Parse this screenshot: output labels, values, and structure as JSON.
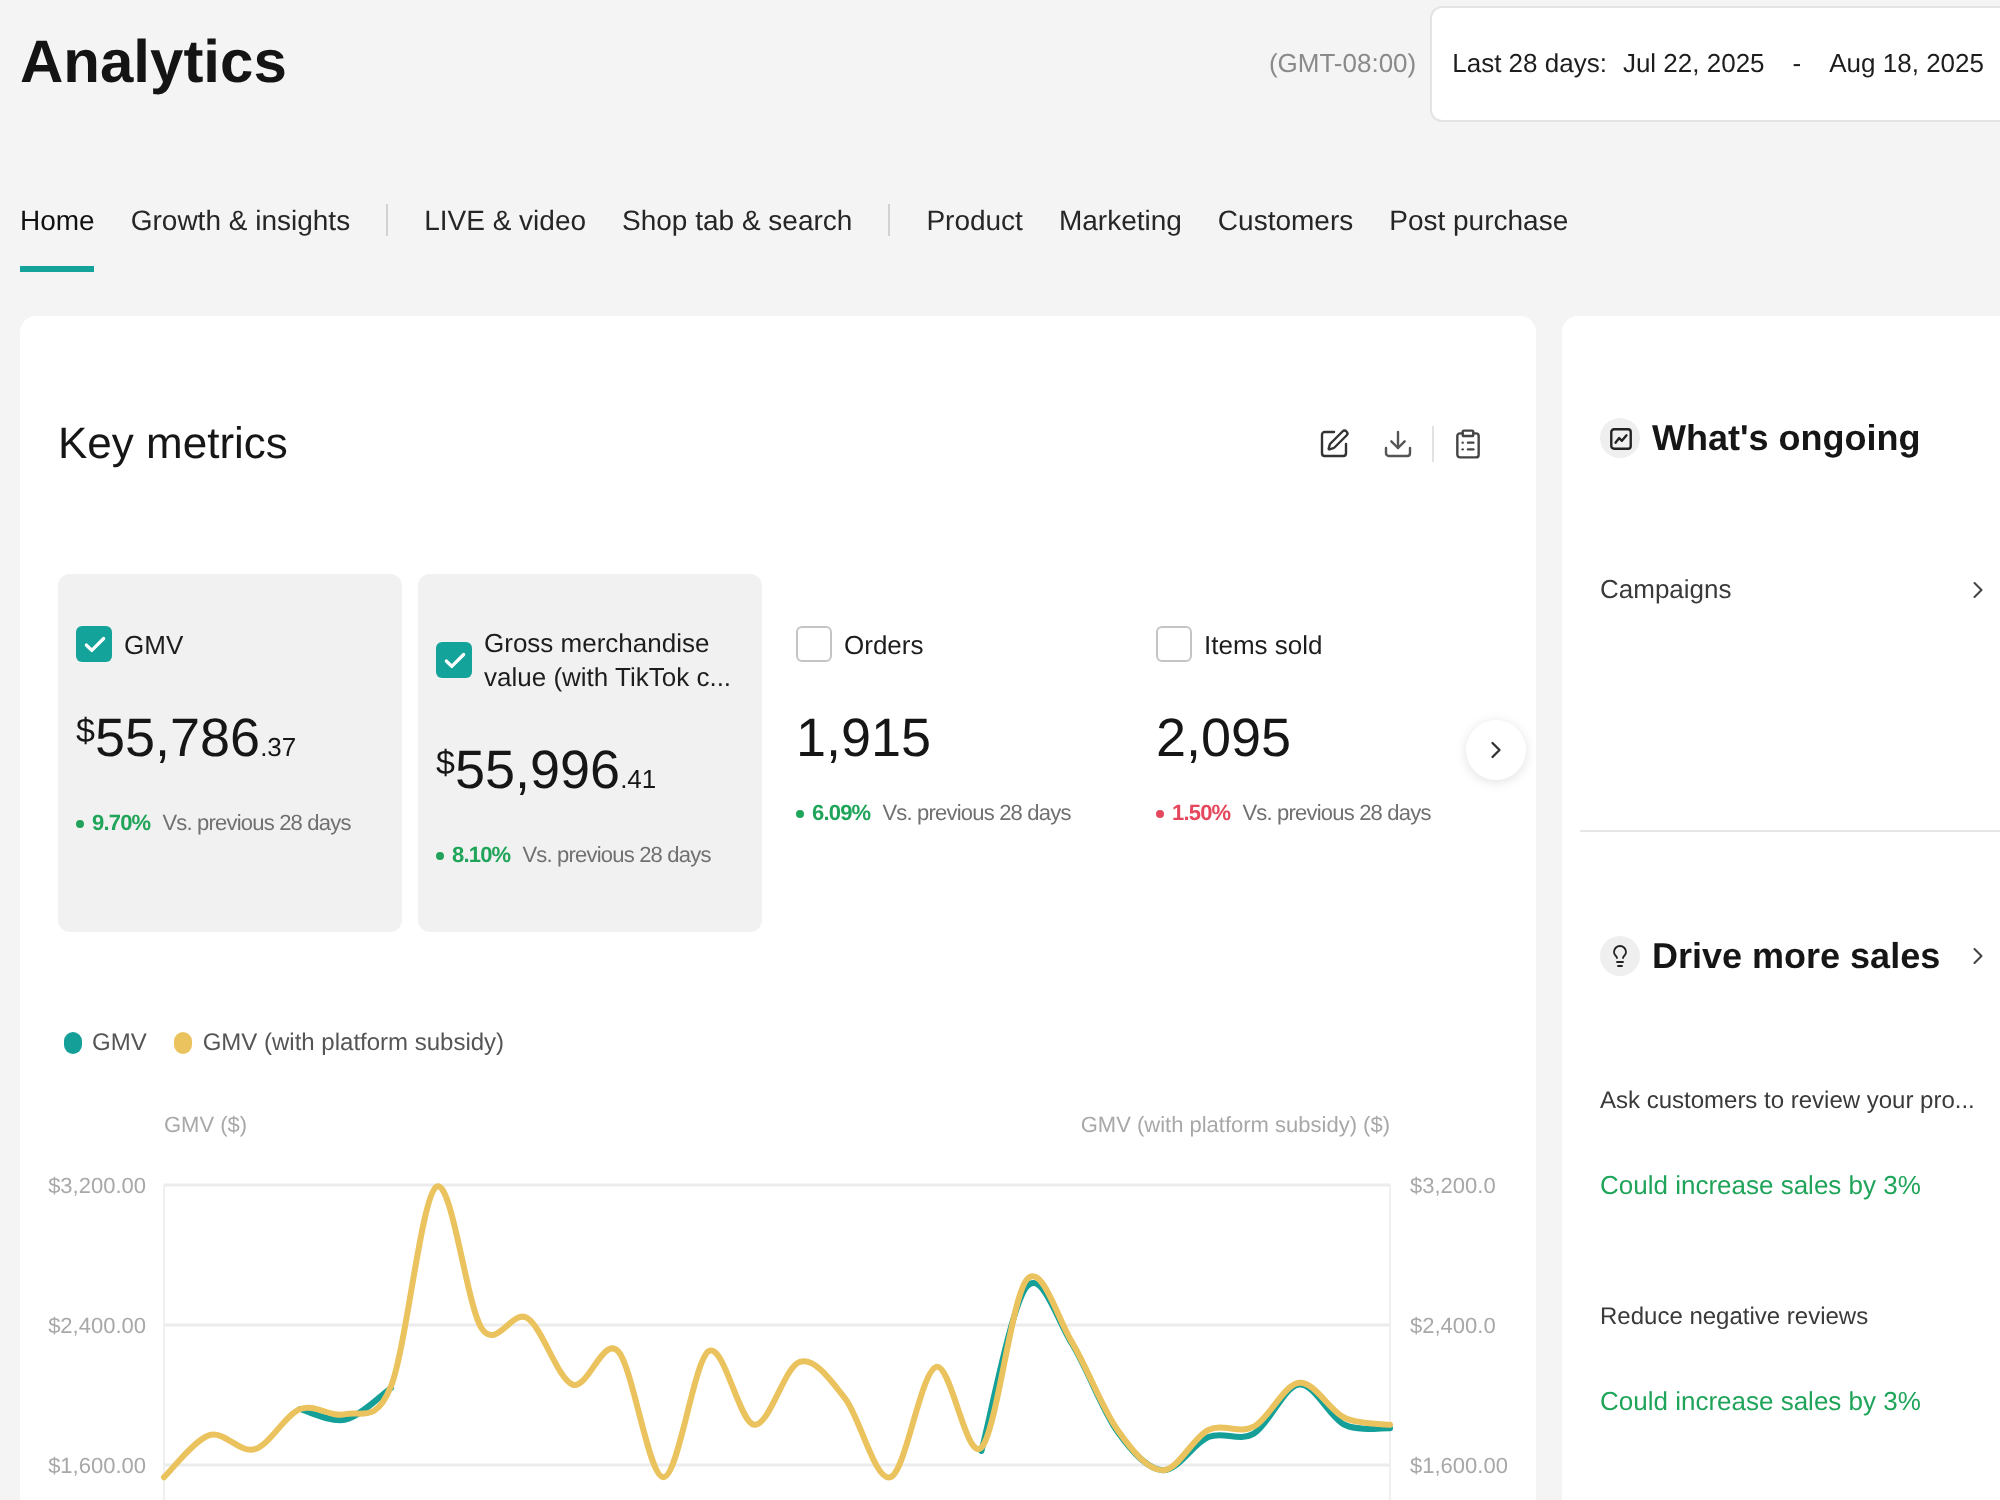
{
  "page": {
    "title": "Analytics",
    "timezone": "(GMT-08:00)",
    "date_range": {
      "label": "Last 28 days:",
      "start": "Jul 22, 2025",
      "separator": "-",
      "end": "Aug 18, 2025"
    }
  },
  "tab_groups": [
    {
      "tabs": [
        {
          "label": "Home",
          "selected": true
        },
        {
          "label": "Growth & insights",
          "selected": false
        }
      ]
    },
    {
      "tabs": [
        {
          "label": "LIVE & video",
          "selected": false
        },
        {
          "label": "Shop tab & search",
          "selected": false
        }
      ]
    },
    {
      "tabs": [
        {
          "label": "Product",
          "selected": false
        },
        {
          "label": "Marketing",
          "selected": false
        },
        {
          "label": "Customers",
          "selected": false
        },
        {
          "label": "Post purchase",
          "selected": false
        }
      ]
    }
  ],
  "key_metrics": {
    "title": "Key metrics",
    "metrics": [
      {
        "label": "GMV",
        "checked": true,
        "currency": "$",
        "amount": "55,786",
        "cents": ".37",
        "positive": true,
        "change": "9.70%",
        "comparison": "Vs. previous 28 days"
      },
      {
        "label": "Gross merchandise value (with TikTok c...",
        "checked": true,
        "currency": "$",
        "amount": "55,996",
        "cents": ".41",
        "positive": true,
        "change": "8.10%",
        "comparison": "Vs. previous 28 days"
      },
      {
        "label": "Orders",
        "checked": false,
        "amount": "1,915",
        "positive": true,
        "change": "6.09%",
        "comparison": "Vs. previous 28 days"
      },
      {
        "label": "Items sold",
        "checked": false,
        "amount": "2,095",
        "positive": false,
        "change": "1.50%",
        "comparison": "Vs. previous 28 days"
      }
    ],
    "chart": {
      "chart_data": {
        "type": "line",
        "ylabel": "GMV ($)",
        "legend": "top",
        "grid": true,
        "ylim": [
          1400,
          3200
        ],
        "yticks": [
          {
            "value": 3200,
            "label": "$3,200.00"
          },
          {
            "value": 2400,
            "label": "$2,400.00"
          },
          {
            "value": 1600,
            "label": "$1,600.00"
          }
        ],
        "series": [
          {
            "name": "GMV",
            "color": "#14a098",
            "values": [
              null,
              null,
              null,
              1920,
              1860,
              2040,
              null,
              null,
              null,
              null,
              null,
              null,
              null,
              null,
              null,
              null,
              null,
              null,
              1680,
              2620,
              2290,
              1790,
              1570,
              1760,
              1780,
              2060,
              1830,
              1810
            ]
          },
          {
            "name": "GMV (with platform subsidy)",
            "color": "#ebc35e",
            "values": [
              1530,
              1770,
              1690,
              1920,
              1890,
              2050,
              3190,
              2380,
              2440,
              2060,
              2250,
              1530,
              2250,
              1830,
              2190,
              1980,
              1530,
              2160,
              1700,
              2660,
              2300,
              1800,
              1570,
              1800,
              1820,
              2070,
              1870,
              1830
            ]
          }
        ]
      },
      "right_axis": {
        "title": "GMV (with platform subsidy) ($)",
        "ticks": [
          "$3,200.0",
          "$2,400.0",
          "$1,600.00"
        ]
      }
    }
  },
  "side_panel": {
    "ongoing": {
      "title": "What's ongoing",
      "items": [
        {
          "label": "Campaigns"
        }
      ]
    },
    "drive_sales": {
      "title": "Drive more sales",
      "suggestions": [
        {
          "title": "Ask customers to review your pro...",
          "impact": "Could increase sales by 3%"
        },
        {
          "title": "Reduce negative reviews",
          "impact": "Could increase sales by 3%"
        }
      ]
    }
  }
}
